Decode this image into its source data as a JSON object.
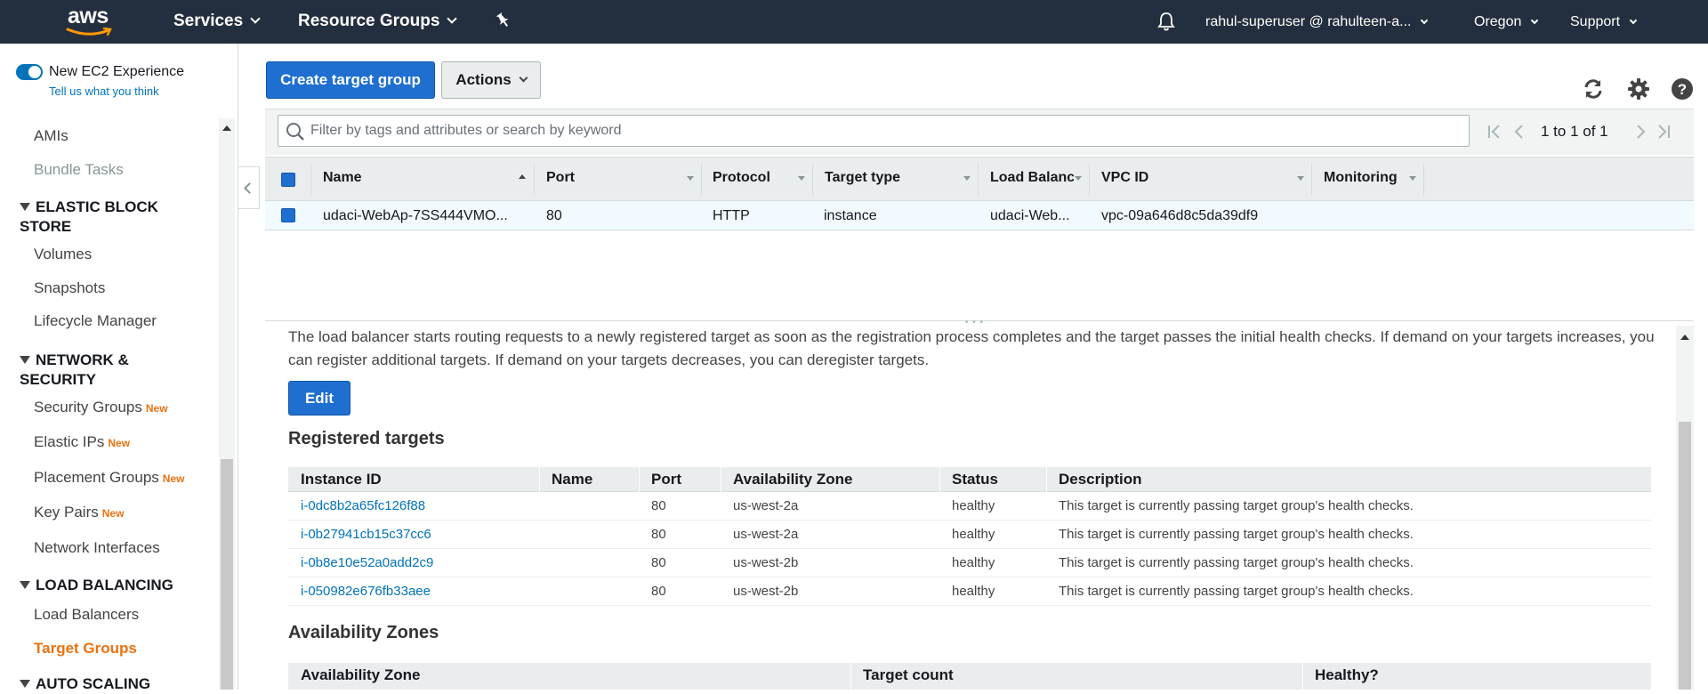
{
  "topnav": {
    "logo": "aws",
    "services": "Services",
    "resource_groups": "Resource Groups",
    "account": "rahul-superuser @ rahulteen-a...",
    "region": "Oregon",
    "support": "Support",
    "icons": [
      "pin-icon",
      "bell-icon"
    ]
  },
  "sidebar": {
    "toggle_label": "New EC2 Experience",
    "feedback_link": "Tell us what you think",
    "items": {
      "amis": "AMIs",
      "bundle_tasks": "Bundle Tasks",
      "section_ebs": "ELASTIC BLOCK STORE",
      "volumes": "Volumes",
      "snapshots": "Snapshots",
      "lifecycle_manager": "Lifecycle Manager",
      "section_network": "NETWORK & SECURITY",
      "security_groups": "Security Groups",
      "elastic_ips": "Elastic IPs",
      "placement_groups": "Placement Groups",
      "key_pairs": "Key Pairs",
      "network_interfaces": "Network Interfaces",
      "section_lb": "LOAD BALANCING",
      "load_balancers": "Load Balancers",
      "target_groups": "Target Groups",
      "section_autoscaling": "AUTO SCALING"
    },
    "new_badge": "New"
  },
  "toolbar": {
    "create_label": "Create target group",
    "actions_label": "Actions",
    "icons": [
      "refresh-icon",
      "gear-icon",
      "help-icon"
    ]
  },
  "filter": {
    "placeholder": "Filter by tags and attributes or search by keyword",
    "pager_text": "1 to 1 of 1"
  },
  "table": {
    "columns": [
      "Name",
      "Port",
      "Protocol",
      "Target type",
      "Load Balanc",
      "VPC ID",
      "Monitoring"
    ],
    "row": {
      "name": "udaci-WebAp-7SS444VMO...",
      "port": "80",
      "protocol": "HTTP",
      "target_type": "instance",
      "load_balancer": "udaci-Web...",
      "vpc_id": "vpc-09a646d8c5da39df9",
      "monitoring": ""
    }
  },
  "details": {
    "description": "The load balancer starts routing requests to a newly registered target as soon as the registration process completes and the target passes the initial health checks. If demand on your targets increases, you can register additional targets. If demand on your targets decreases, you can deregister targets.",
    "edit_label": "Edit",
    "registered_title": "Registered targets",
    "registered_columns": [
      "Instance ID",
      "Name",
      "Port",
      "Availability Zone",
      "Status",
      "Description"
    ],
    "registered_rows": [
      {
        "instance_id": "i-0dc8b2a65fc126f88",
        "name": "",
        "port": "80",
        "az": "us-west-2a",
        "status": "healthy",
        "description": "This target is currently passing target group's health checks."
      },
      {
        "instance_id": "i-0b27941cb15c37cc6",
        "name": "",
        "port": "80",
        "az": "us-west-2a",
        "status": "healthy",
        "description": "This target is currently passing target group's health checks."
      },
      {
        "instance_id": "i-0b8e10e52a0add2c9",
        "name": "",
        "port": "80",
        "az": "us-west-2b",
        "status": "healthy",
        "description": "This target is currently passing target group's health checks."
      },
      {
        "instance_id": "i-050982e676fb33aee",
        "name": "",
        "port": "80",
        "az": "us-west-2b",
        "status": "healthy",
        "description": "This target is currently passing target group's health checks."
      }
    ],
    "az_title": "Availability Zones",
    "az_columns": [
      "Availability Zone",
      "Target count",
      "Healthy?"
    ]
  },
  "colors": {
    "nav_bg": "#232f3e",
    "primary": "#1f6fd1",
    "link": "#0073bb",
    "active_nav": "#ec7211"
  }
}
